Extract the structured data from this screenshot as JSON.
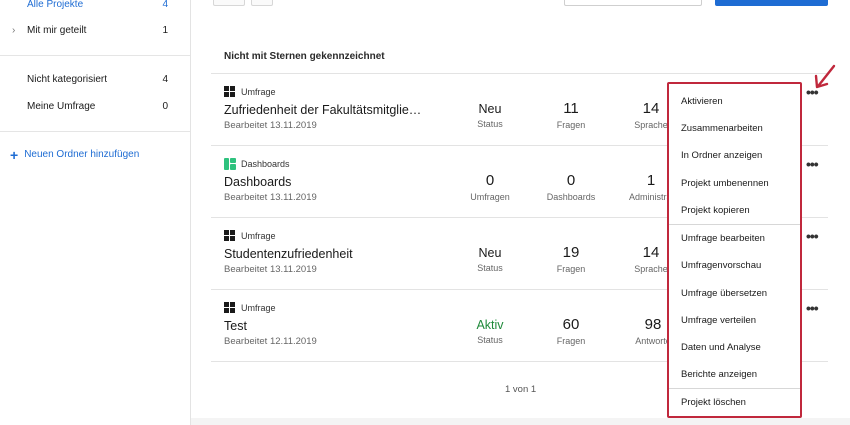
{
  "sidebar": {
    "items": [
      {
        "label": "Alle Projekte",
        "count": "4",
        "active": true
      },
      {
        "label": "Mit mir geteilt",
        "count": "1",
        "chevron": "›"
      },
      {
        "label": "Nicht kategorisiert",
        "count": "4"
      },
      {
        "label": "Meine Umfrage",
        "count": "0"
      }
    ],
    "add_folder": "Neuen Ordner hinzufügen",
    "add_icon": "+"
  },
  "main": {
    "section_title": "Nicht mit Sternen gekennzeichnet",
    "rows": [
      {
        "type": "Umfrage",
        "name": "Zufriedenheit der Fakultätsmitglie…",
        "edited": "Bearbeitet 13.11.2019",
        "stats": [
          {
            "value": "Neu",
            "label": "Status"
          },
          {
            "value": "11",
            "label": "Fragen"
          },
          {
            "value": "14",
            "label": "Sprache"
          }
        ]
      },
      {
        "type": "Dashboards",
        "name": "Dashboards",
        "edited": "Bearbeitet 13.11.2019",
        "stats": [
          {
            "value": "0",
            "label": "Umfragen"
          },
          {
            "value": "0",
            "label": "Dashboards"
          },
          {
            "value": "1",
            "label": "Administrat"
          }
        ]
      },
      {
        "type": "Umfrage",
        "name": "Studentenzufriedenheit",
        "edited": "Bearbeitet 13.11.2019",
        "stats": [
          {
            "value": "Neu",
            "label": "Status"
          },
          {
            "value": "19",
            "label": "Fragen"
          },
          {
            "value": "14",
            "label": "Sprache"
          }
        ]
      },
      {
        "type": "Umfrage",
        "name": "Test",
        "edited": "Bearbeitet 12.11.2019",
        "stats": [
          {
            "value": "Aktiv",
            "label": "Status"
          },
          {
            "value": "60",
            "label": "Fragen"
          },
          {
            "value": "98",
            "label": "Antworte"
          }
        ]
      }
    ],
    "kebab": "•••",
    "pager": "1 von 1"
  },
  "menu": {
    "items": [
      "Aktivieren",
      "Zusammenarbeiten",
      "In Ordner anzeigen",
      "Projekt umbenennen",
      "Projekt kopieren",
      "Umfrage bearbeiten",
      "Umfragenvorschau",
      "Umfrage übersetzen",
      "Umfrage verteilen",
      "Daten und Analyse",
      "Berichte anzeigen",
      "Projekt löschen"
    ]
  },
  "colors": {
    "accent": "#1e6cd3",
    "highlight": "#c0283c",
    "active_status": "#1f8a3a",
    "dashboard_icon": "#2ec27e"
  }
}
